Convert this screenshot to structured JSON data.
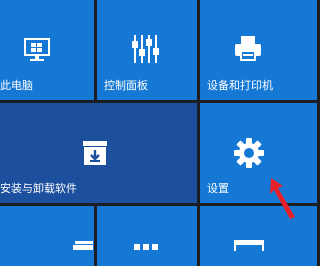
{
  "tiles": {
    "this_pc": {
      "label": "此电脑",
      "icon": "monitor-icon"
    },
    "control_panel": {
      "label": "控制面板",
      "icon": "sliders-icon"
    },
    "devices_printers": {
      "label": "设备和打印机",
      "icon": "printer-icon"
    },
    "install_uninstall": {
      "label": "安装与卸载软件",
      "icon": "install-box-icon"
    },
    "settings": {
      "label": "设置",
      "icon": "gear-icon"
    },
    "bottom_tiles": [
      {
        "icon": "window-icon"
      },
      {
        "icon": "grid-icon"
      },
      {
        "icon": "calendar-icon"
      }
    ]
  },
  "annotation": {
    "icon": "red-arrow-icon",
    "color": "#e8202a"
  },
  "colors": {
    "tile_blue": "#1478d4",
    "tile_dark_blue": "#1c4f9e",
    "background": "#1b1d21",
    "text": "#ffffff"
  }
}
